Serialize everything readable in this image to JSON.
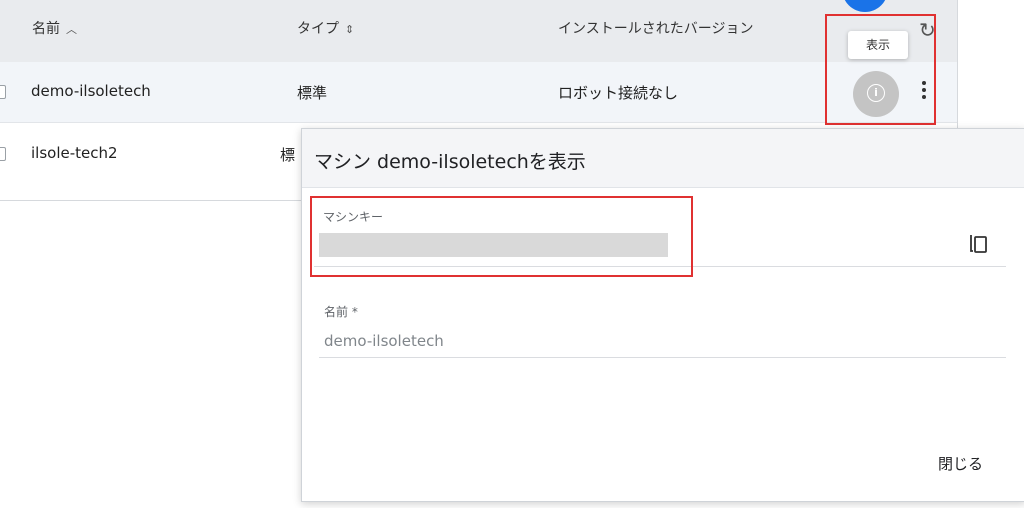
{
  "table": {
    "columns": [
      {
        "label": "名前",
        "sort_icon": "chevron-up-icon"
      },
      {
        "label": "タイプ",
        "sort_icon": "unfold-icon"
      },
      {
        "label": "インストールされたバージョン"
      }
    ],
    "rows": [
      {
        "name": "demo-ilsoletech",
        "type": "標準",
        "version": "ロボット接続なし"
      },
      {
        "name": "ilsole-tech2",
        "type": "標"
      }
    ],
    "tooltip": "表示",
    "action_icons": [
      "refresh-icon",
      "info-icon",
      "more-vert-icon"
    ]
  },
  "dialog": {
    "title": "マシン demo-ilsoletechを表示",
    "machine_key_label": "マシンキー",
    "machine_key_value": "",
    "name_label": "名前 *",
    "name_value": "demo-ilsoletech",
    "close_label": "閉じる",
    "copy_icon": "copy-icon"
  },
  "colors": {
    "highlight": "#e03131",
    "accent": "#1a73e8",
    "header_bg": "#e9ebee"
  }
}
